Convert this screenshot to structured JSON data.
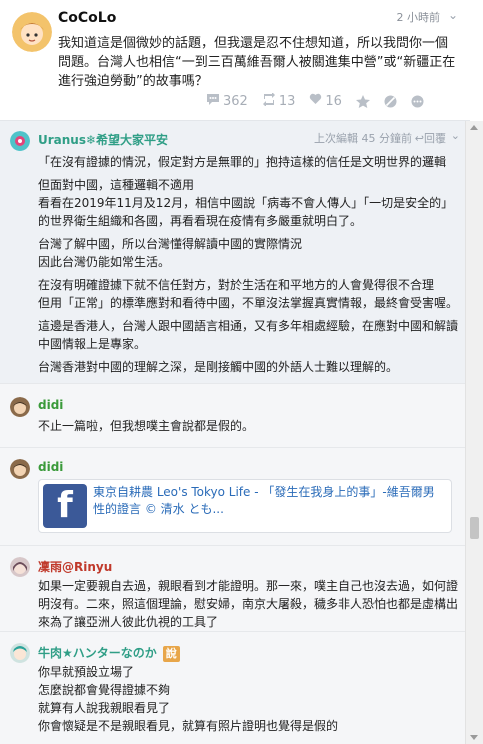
{
  "post": {
    "author": "CoCoLo",
    "time": "2 小時前",
    "content": "我知道這是個微妙的話題，但我還是忍不住想知道，所以我問你一個問題。台灣人也相信“一到三百萬維吾爾人被關進集中營”或“新疆正在進行強迫勞動”的故事嗎？",
    "comment_count": "362",
    "repost_count": "13",
    "like_count": "16"
  },
  "comments": [
    {
      "author": "Uranus❄希望大家平安",
      "author_color": "#2f9e86",
      "meta": "上次編輯 45 分鐘前",
      "reply": "回覆",
      "paragraphs": [
        "「在沒有證據的情況，假定對方是無罪的」抱持這樣的信任是文明世界的邏輯",
        "但面對中國，這種邏輯不適用\n看看在2019年11月及12月，相信中國說「病毒不會人傳人」「一切是安全的」的世界衛生組織和各國，再看看現在疫情有多嚴重就明白了。",
        "台灣了解中國，所以台灣懂得解讀中國的實際情況\n因此台灣仍能如常生活。",
        "在沒有明確證據下就不信任對方，對於生活在和平地方的人會覺得很不合理\n但用「正常」的標準應對和看待中國，不單沒法掌握真實情報，最終會受害喔。",
        "這邊是香港人，台灣人跟中國語言相通，又有多年相處經驗，在應對中國和解讀中國情報上是專家。",
        "台灣香港對中國的理解之深，是剛接觸中國的外語人士難以理解的。"
      ]
    },
    {
      "author": "didi",
      "author_color": "#3a9a3a",
      "text": "不止一篇啦，但我想噗主會說都是假的。"
    },
    {
      "author": "didi",
      "author_color": "#3a9a3a",
      "link_title": "東京自耕農 Leo's Tokyo Life - 「發生在我身上的事」-維吾爾男性的證言 © 清水 とも..."
    },
    {
      "author": "凜雨@Rinyu",
      "author_color": "#c0392b",
      "text": "如果一定要親自去過，親眼看到才能證明。那一來，噗主自己也沒去過，如何證明沒有。二來，照這個理論，慰安婦，南京大屠殺，穢多非人恐怕也都是虛構出來為了讓亞洲人彼此仇視的工具了"
    },
    {
      "author": "牛肉★ハンターなのか",
      "author_color": "#2f9e86",
      "badge": "說",
      "text": "你早就預設立場了\n怎麼說都會覺得證據不夠\n就算有人說我親眼看見了\n你會懷疑是不是親眼看見，就算有照片證明也覺得是假的"
    }
  ]
}
